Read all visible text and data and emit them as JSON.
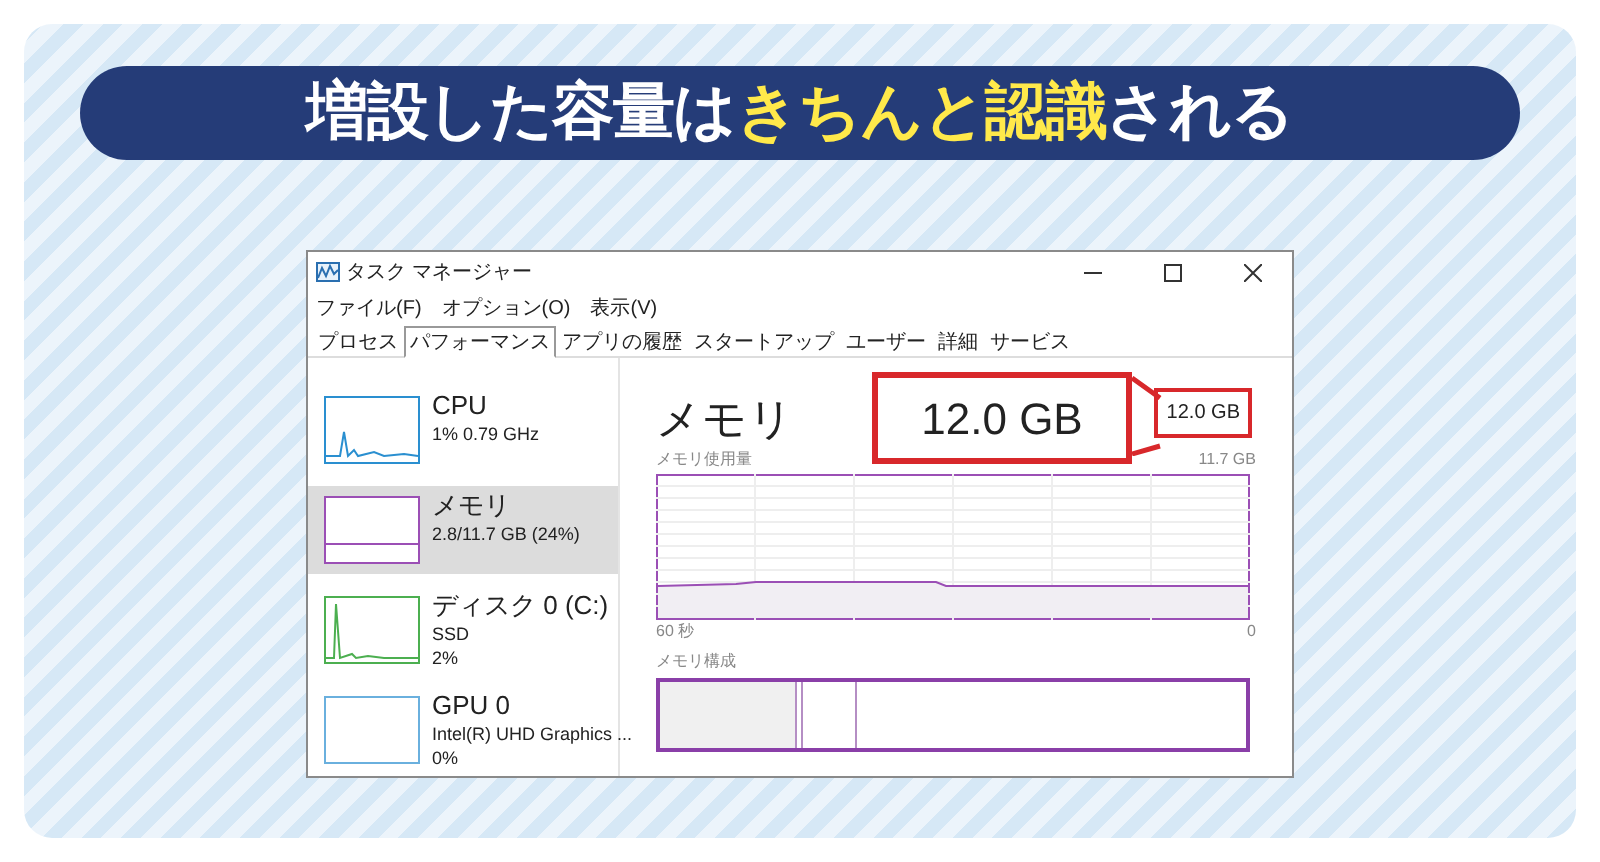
{
  "banner": {
    "title": [
      {
        "text": "増設した容量は",
        "highlight": false
      },
      {
        "text": "きちんと認識",
        "highlight": true
      },
      {
        "text": "される",
        "highlight": false
      }
    ]
  },
  "window": {
    "title": "タスク マネージャー",
    "menu": [
      "ファイル(F)",
      "オプション(O)",
      "表示(V)"
    ],
    "tabs": [
      {
        "label": "プロセス",
        "selected": false
      },
      {
        "label": "パフォーマンス",
        "selected": true
      },
      {
        "label": "アプリの履歴",
        "selected": false
      },
      {
        "label": "スタートアップ",
        "selected": false
      },
      {
        "label": "ユーザー",
        "selected": false
      },
      {
        "label": "詳細",
        "selected": false
      },
      {
        "label": "サービス",
        "selected": false
      }
    ]
  },
  "sidebar": {
    "items": [
      {
        "kind": "cpu",
        "name": "CPU",
        "lines": [
          "1% 0.79 GHz"
        ],
        "selected": false,
        "color": "#2a8fd0"
      },
      {
        "kind": "memory",
        "name": "メモリ",
        "lines": [
          "2.8/11.7 GB (24%)"
        ],
        "selected": true,
        "color": "#9b4fb5"
      },
      {
        "kind": "disk",
        "name": "ディスク 0 (C:)",
        "lines": [
          "SSD",
          "2%"
        ],
        "selected": false,
        "color": "#4caf50"
      },
      {
        "kind": "gpu",
        "name": "GPU 0",
        "lines": [
          "Intel(R) UHD Graphics ...",
          "0%"
        ],
        "selected": false,
        "color": "#6ab0de"
      }
    ]
  },
  "detail": {
    "title": "メモリ",
    "total": "12.0 GB",
    "usage_label": "メモリ使用量",
    "usage_max": "11.7 GB",
    "time_start": "60 秒",
    "time_end": "0",
    "composition_label": "メモリ構成"
  },
  "callout": {
    "text": "12.0 GB"
  }
}
